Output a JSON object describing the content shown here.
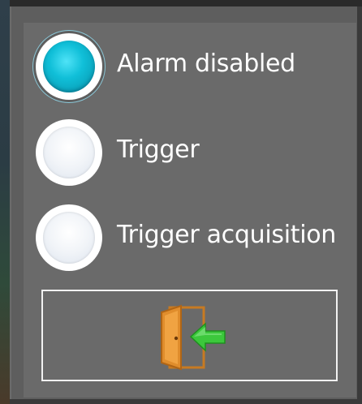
{
  "options": [
    {
      "label": "Alarm disabled",
      "checked": true
    },
    {
      "label": "Trigger",
      "checked": false
    },
    {
      "label": "Trigger acquisition",
      "checked": false
    }
  ],
  "exit_button": {
    "icon": "exit-door-icon"
  },
  "colors": {
    "selected_radio": "#10bfd8",
    "panel_bg": "#6a6a6a",
    "text": "#ffffff",
    "door": "#d98a2b",
    "arrow": "#3cc83c"
  }
}
